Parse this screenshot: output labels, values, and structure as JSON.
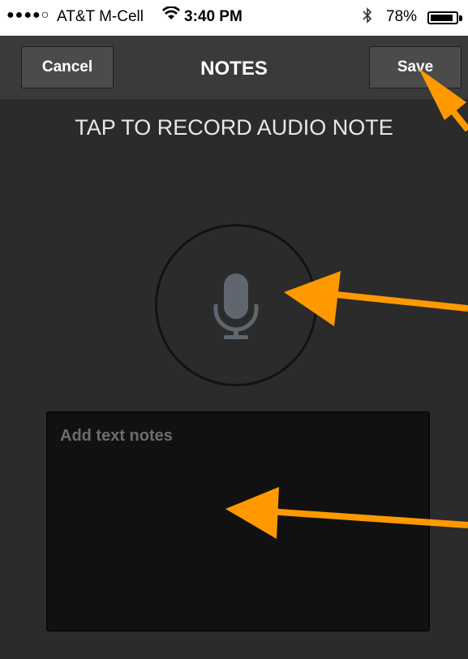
{
  "status_bar": {
    "signal": "●●●●○",
    "carrier": "AT&T M-Cell",
    "time": "3:40 PM",
    "battery_percent": "78%",
    "battery_level": 0.78,
    "icons": [
      "signal-dots-icon",
      "wifi-icon",
      "bluetooth-icon",
      "battery-icon"
    ]
  },
  "nav": {
    "cancel_label": "Cancel",
    "title": "NOTES",
    "save_label": "Save"
  },
  "main": {
    "record_prompt": "TAP TO RECORD AUDIO NOTE",
    "mic_icon": "microphone-icon",
    "notes_placeholder": "Add text notes",
    "notes_value": ""
  },
  "colors": {
    "background": "#2b2b2b",
    "nav_background": "#3a3a3a",
    "annotation_arrow": "#ff9900",
    "mic": "#5f6670"
  }
}
